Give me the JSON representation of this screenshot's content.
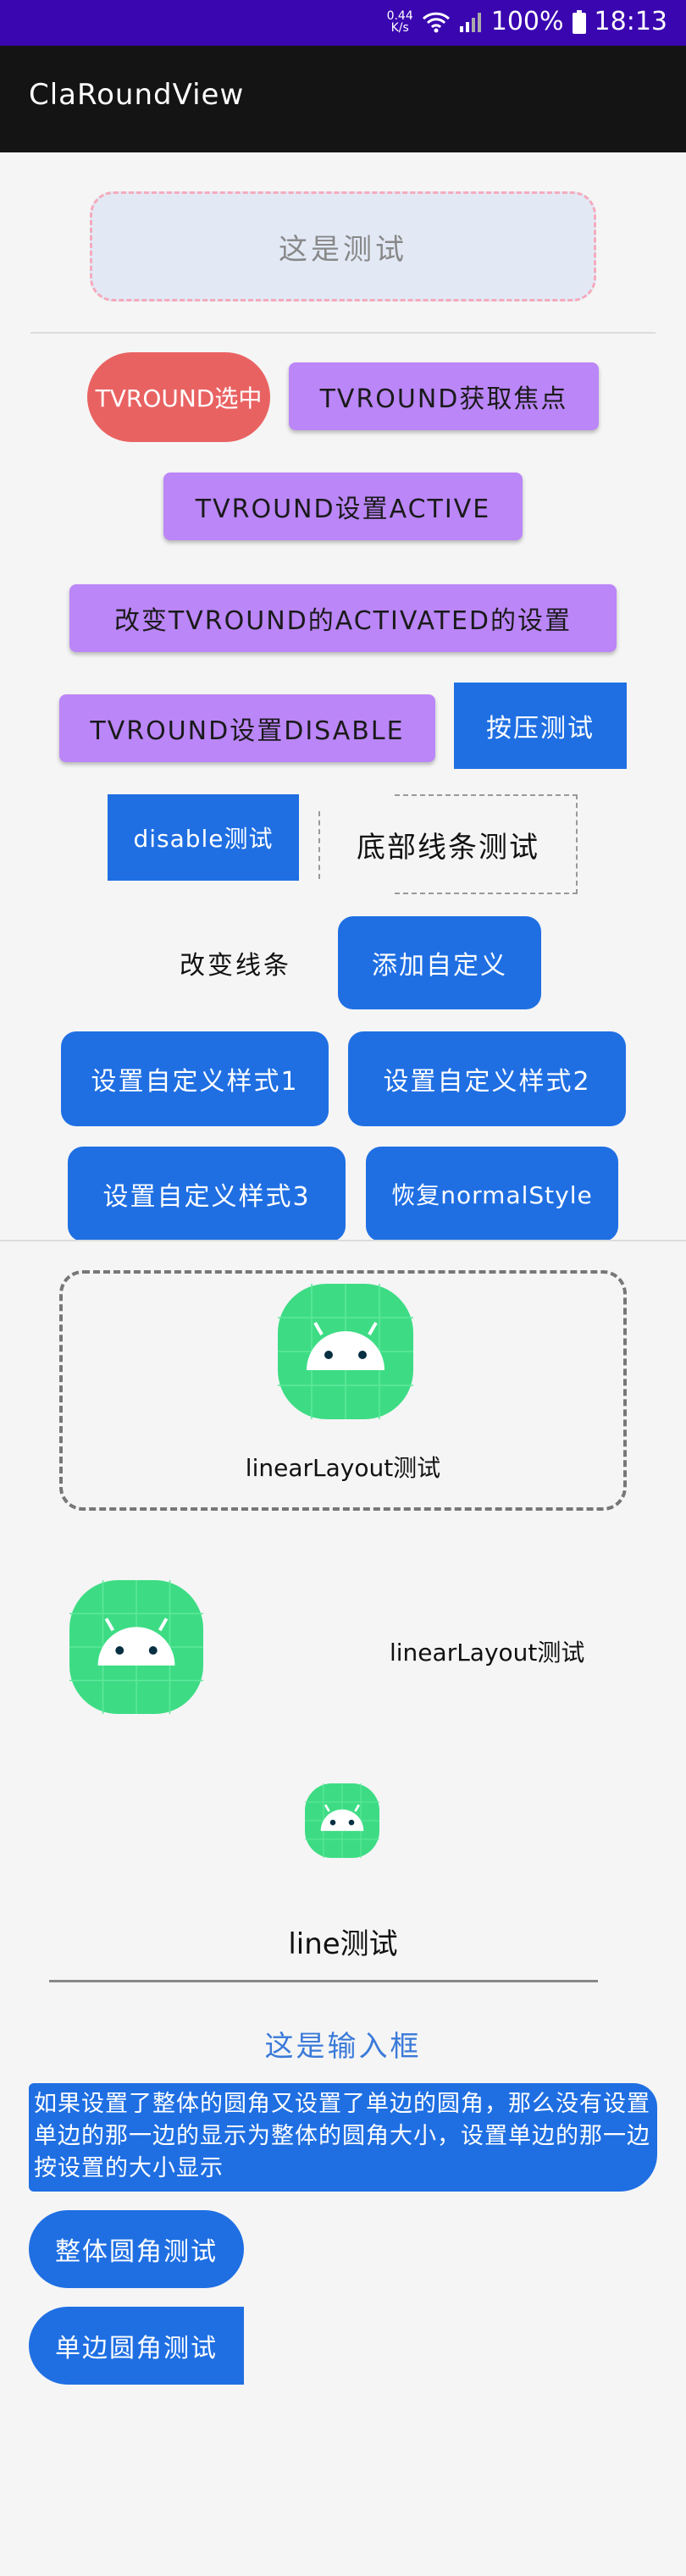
{
  "status_bar": {
    "net_speed_top": "0.44",
    "net_speed_bottom": "K/s",
    "battery": "100%",
    "time": "18:13",
    "icons": [
      "wifi-icon",
      "signal-icon",
      "battery-icon"
    ]
  },
  "app_bar": {
    "title": "ClaRoundView"
  },
  "colors": {
    "purple": "#bb86f8",
    "blue": "#1f6fe3",
    "red": "#e96262",
    "status": "#3a06b0",
    "appbar": "#141414",
    "android_green": "#3ddc84"
  },
  "buttons": {
    "test": "这是测试",
    "tv_selected": "TVROUND选中",
    "tv_focus": "TVROUND获取焦点",
    "tv_active": "TVROUND设置ACTIVE",
    "tv_change_activated": "改变TVROUND的ACTIVATED的设置",
    "tv_disable": "TVROUND设置DISABLE",
    "press_test": "按压测试",
    "disable_test": "disable测试",
    "bottom_line_test": "底部线条测试",
    "change_line": "改变线条",
    "add_custom": "添加自定义",
    "custom_style1": "设置自定义样式1",
    "custom_style2": "设置自定义样式2",
    "custom_style3": "设置自定义样式3",
    "restore_normal": "恢复normalStyle"
  },
  "layout": {
    "linear_test_1": "linearLayout测试",
    "linear_test_2": "linearLayout测试",
    "line_test": "line测试"
  },
  "input": {
    "hint": "这是输入框"
  },
  "note": {
    "text": "如果设置了整体的圆角又设置了单边的圆角，那么没有设置单边的那一边的显示为整体的圆角大小，设置单边的那一边按设置的大小显示"
  },
  "corner_buttons": {
    "whole": "整体圆角测试",
    "single": "单边圆角测试"
  }
}
